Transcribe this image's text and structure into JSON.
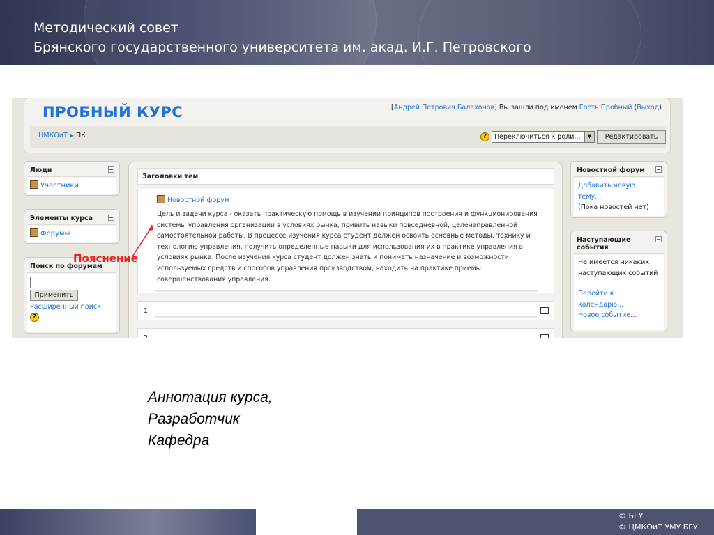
{
  "slide": {
    "title_line1": "Методический совет",
    "title_line2": "Брянского государственного университета  им. акад. И.Г. Петровского"
  },
  "course": {
    "title": "ПРОБНЫЙ КУРС",
    "login": {
      "bracket_open": "[",
      "user_name": "Андрей Петрович Балахонов",
      "middle_text": "] Вы зашли под именем ",
      "guest_name": "Гость Пробный",
      "paren_open": " (",
      "logout": "Выход",
      "paren_close": ")"
    },
    "breadcrumb": {
      "home": "ЦМКОиТ",
      "separator": "►",
      "current": "ПК"
    },
    "help_symbol": "?",
    "role_select": {
      "value": "Переключиться к роли..."
    },
    "edit_button": "Редактировать"
  },
  "left_blocks": {
    "people": {
      "title": "Люди",
      "items": [
        "Участники"
      ]
    },
    "elements": {
      "title": "Элементы курса",
      "items": [
        "Форумы"
      ]
    },
    "search": {
      "title": "Поиск по форумам",
      "input_value": "",
      "apply_button": "Применить",
      "advanced_link": "Расширенный поиск"
    }
  },
  "main": {
    "topics_header": "Заголовки тем",
    "news_forum_link": "Новостной форум",
    "course_description": "Цель и задачи курса - оказать практическую помощь в изучении принципов построения и функционирования системы управления организации в условиях рынка, привить навыки повседневной, целенаправленной самостоятельной работы. В процессе изучения курса студент должен освоить основные методы, технику и технологию управления, получить определенные навыки для использования их в практике управления в условиях рынка. После изучения курса студент должен знать и понимать назначение и возможности используемых средств и способов управления производством, находить на практике приемы совершенствования управления.",
    "topic_numbers": [
      "1",
      "2"
    ]
  },
  "right_blocks": {
    "news": {
      "title": "Новостной форум",
      "add_link": "Добавить новую тему...",
      "no_news": "(Пока новостей нет)"
    },
    "events": {
      "title": "Наступающие события",
      "none_text": "Не имеется никаких наступающих событий",
      "calendar_link": "Перейти к календарю...",
      "new_event_link": "Новое событие..."
    }
  },
  "annotation": {
    "label": "Пояснение",
    "color": "#e8251f"
  },
  "caption": {
    "line1": "Аннотация курса,",
    "line2": "Разработчик",
    "line3": "Кафедра"
  },
  "footer": {
    "line1": "© БГУ",
    "line2": "© ЦМКОиТ УМУ БГУ"
  },
  "colors": {
    "link_blue": "#1e73d6",
    "header_bg": "#4a5270",
    "annotation_red": "#e8251f"
  }
}
